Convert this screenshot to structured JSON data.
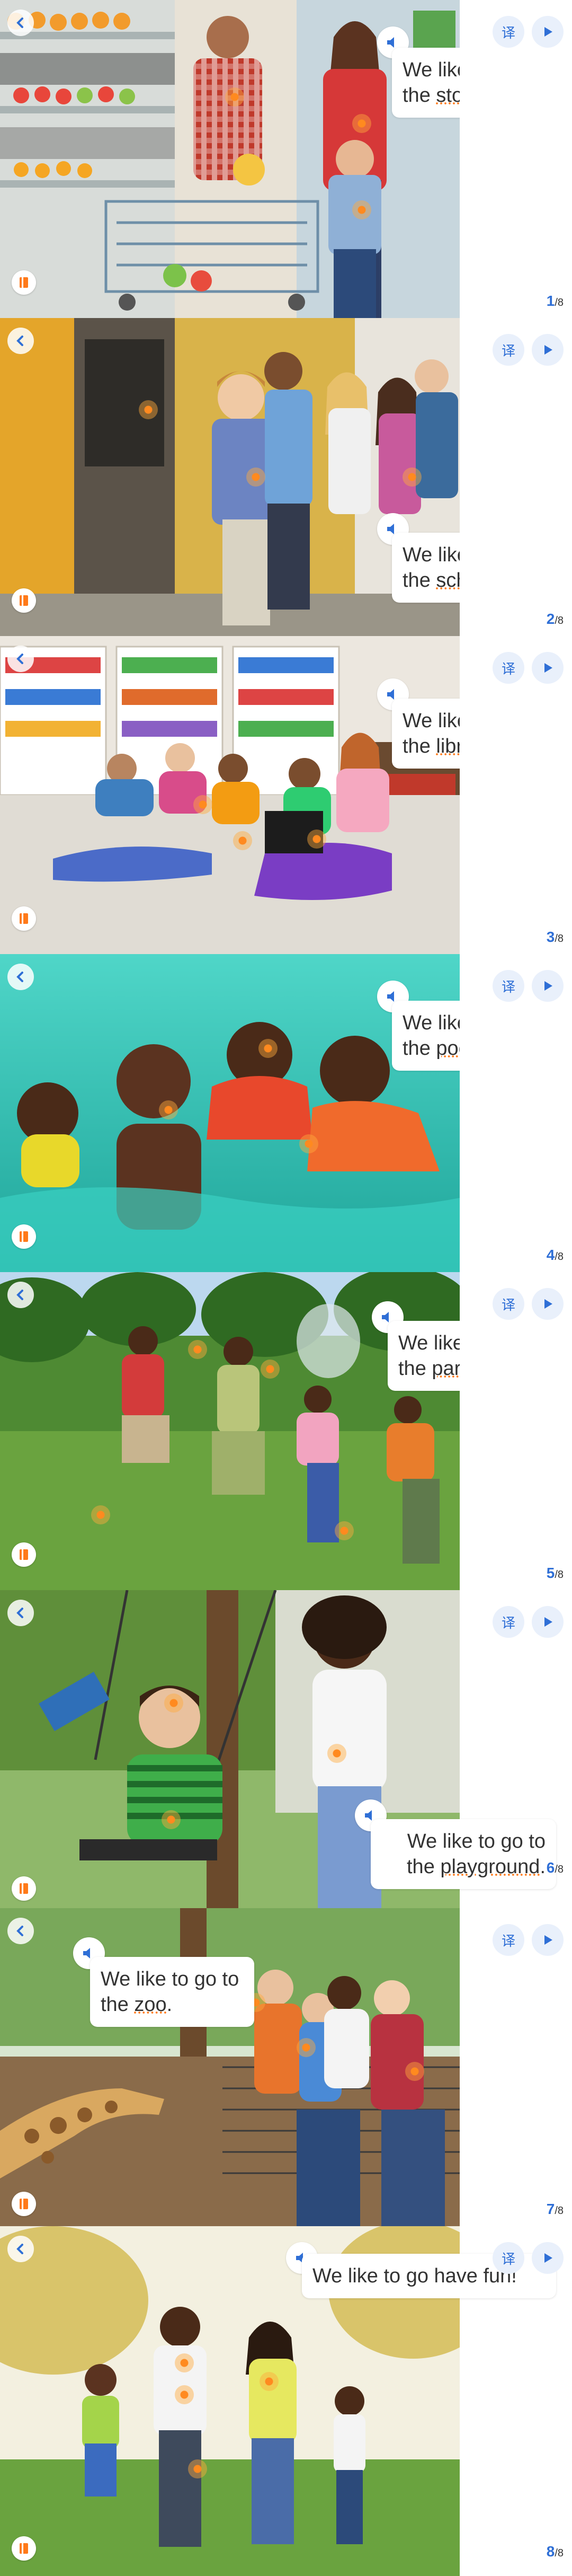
{
  "pages": [
    {
      "sentence_prefix": "We like to go to the ",
      "keyword": "store",
      "suffix": ".",
      "current": "1",
      "total": "/8"
    },
    {
      "sentence_prefix": "We like to go to the ",
      "keyword": "school",
      "suffix": ".",
      "current": "2",
      "total": "/8"
    },
    {
      "sentence_prefix": "We like to go to the ",
      "keyword": "library",
      "suffix": ".",
      "current": "3",
      "total": "/8"
    },
    {
      "sentence_prefix": "We like to go to the ",
      "keyword": "pool",
      "suffix": ".",
      "current": "4",
      "total": "/8"
    },
    {
      "sentence_prefix": "We like to go to the ",
      "keyword": "park",
      "suffix": ".",
      "current": "5",
      "total": "/8"
    },
    {
      "sentence_prefix": "We like to go to the ",
      "keyword": "playground",
      "suffix": ".",
      "current": "6",
      "total": "/8"
    },
    {
      "sentence_prefix": "We like to go to the ",
      "keyword": "zoo",
      "suffix": ".",
      "current": "7",
      "total": "/8"
    },
    {
      "sentence_prefix": "We like to go have fun!",
      "keyword": "",
      "suffix": "",
      "current": "8",
      "total": "/8"
    }
  ],
  "controls": {
    "translate_glyph": "译"
  },
  "colors": {
    "accent_blue": "#2f6fd6",
    "hotspot_orange": "#ff8a1f",
    "note_orange": "#ff7a1a"
  },
  "icons": [
    "back-icon",
    "note-icon",
    "speaker-icon",
    "translate-icon",
    "play-icon"
  ]
}
